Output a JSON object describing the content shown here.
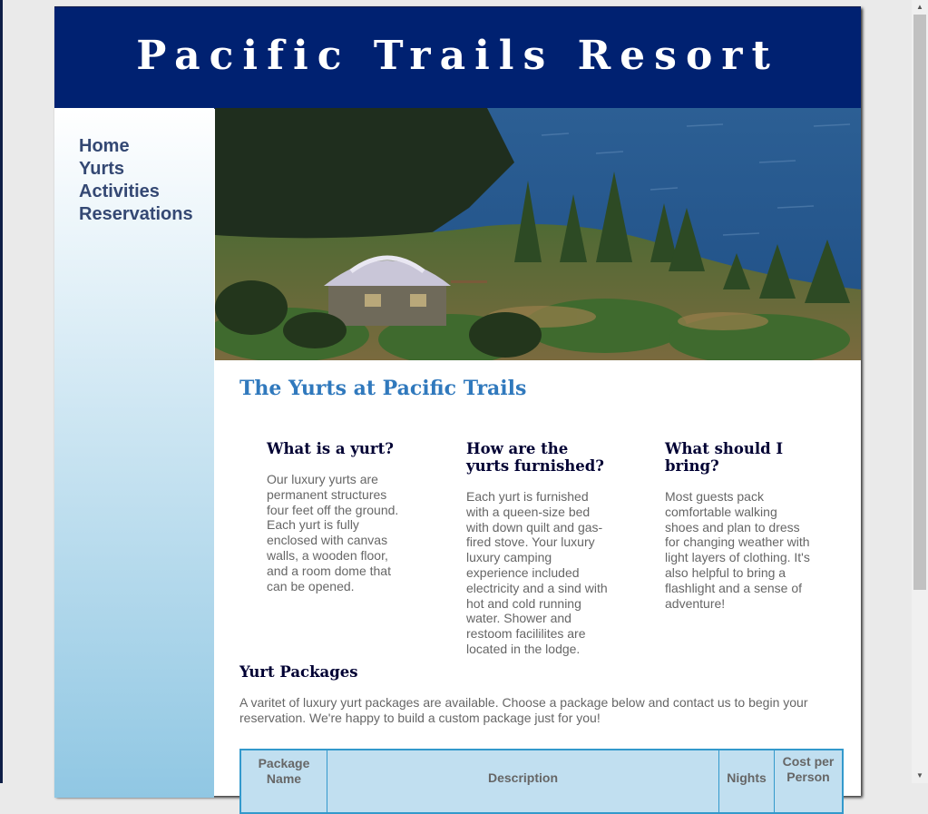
{
  "header": {
    "title": "Pacific Trails Resort"
  },
  "nav": {
    "items": [
      "Home",
      "Yurts",
      "Activities",
      "Reservations"
    ]
  },
  "main": {
    "heading": "The Yurts at Pacific Trails",
    "columns": [
      {
        "title": "What is a yurt?",
        "text": "Our luxury yurts are permanent structures four feet off the ground. Each yurt is fully enclosed with canvas walls, a wooden floor, and a room dome that can be opened."
      },
      {
        "title": "How are the yurts furnished?",
        "text": "Each yurt is furnished with a queen-size bed with down quilt and gas-fired stove. Your luxury luxury camping experience included electricity and a sind with hot and cold running water. Shower and restoom facililites are located in the lodge."
      },
      {
        "title": "What should I bring?",
        "text": "Most guests pack comfortable walking shoes and plan to dress for changing weather with light layers of clothing. It's also helpful to bring a flashlight and a sense of adventure!"
      }
    ],
    "packages_title": "Yurt Packages",
    "packages_text": "A varitet of luxury yurt packages are available. Choose a package below and contact us to begin your reservation. We're happy to build a custom package just for you!",
    "table_headers": [
      "Package Name",
      "Description",
      "Nights",
      "Cost per Person"
    ]
  },
  "colors": {
    "header_bg": "#002171",
    "heading_blue": "#3079bd",
    "table_header_bg": "#c1dff0",
    "table_border": "#3399cc",
    "nav_text": "#344873"
  }
}
